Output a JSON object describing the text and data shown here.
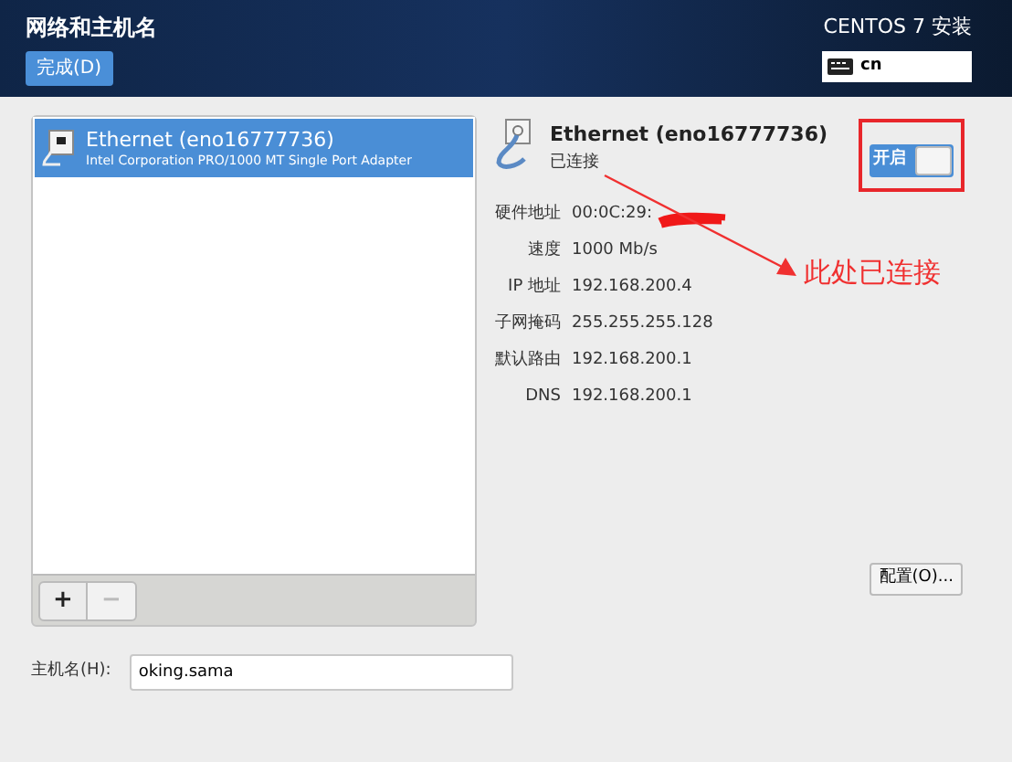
{
  "header": {
    "title": "网络和主机名",
    "done_button": "完成(D)",
    "product": "CENTOS 7 安装",
    "keyboard": "cn"
  },
  "devices": [
    {
      "name": "Ethernet (eno16777736)",
      "description": "Intel Corporation PRO/1000 MT Single Port Adapter",
      "selected": true
    }
  ],
  "list_toolbar": [
    {
      "label": "+",
      "disabled": false
    },
    {
      "label": "−",
      "disabled": true
    }
  ],
  "detail": {
    "name": "Ethernet (eno16777736)",
    "status": "已连接",
    "toggle": {
      "label": "开启",
      "on": true
    },
    "fields": [
      {
        "label": "硬件地址",
        "value": "00:0C:29:"
      },
      {
        "label": "速度",
        "value": "1000 Mb/s"
      },
      {
        "label": "IP 地址",
        "value": "192.168.200.4"
      },
      {
        "label": "子网掩码",
        "value": "255.255.255.128"
      },
      {
        "label": "默认路由",
        "value": "192.168.200.1"
      },
      {
        "label": "DNS",
        "value": "192.168.200.1"
      }
    ],
    "configure_button": "配置(O)..."
  },
  "hostname": {
    "label": "主机名(H):",
    "value": "oking.sama"
  },
  "annotation": {
    "text": "此处已连接"
  }
}
